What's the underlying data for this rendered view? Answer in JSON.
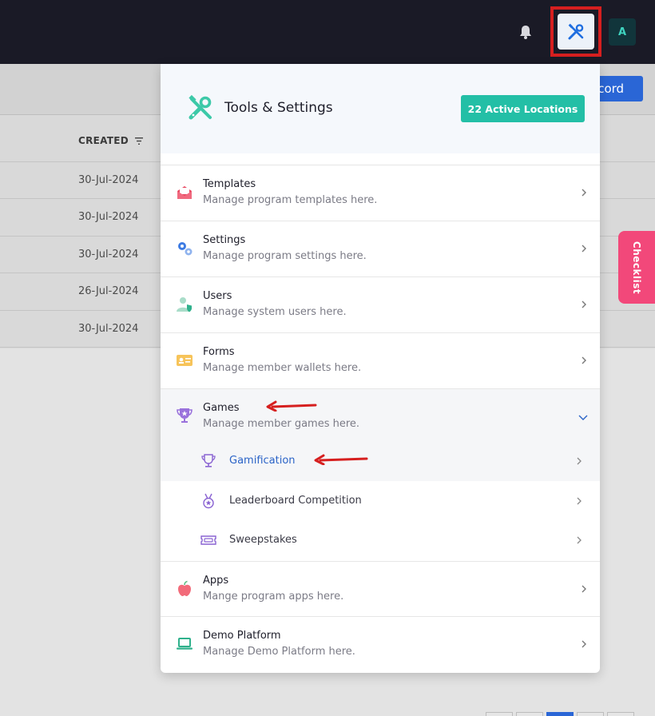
{
  "header": {
    "notifications_icon": "bell-icon",
    "tools_icon": "tools-icon",
    "avatar_initial": "A",
    "highlight_color": "#d61f1f"
  },
  "background_page": {
    "add_button_label": "ecord",
    "column_header": "CREATED",
    "rows": [
      "30-Jul-2024",
      "30-Jul-2024",
      "30-Jul-2024",
      "26-Jul-2024",
      "30-Jul-2024"
    ],
    "checklist_label": "Checklist"
  },
  "panel": {
    "title": "Tools & Settings",
    "locations_button": "22 Active Locations",
    "accent": "#23bfa6",
    "items": [
      {
        "title": "Templates",
        "subtitle": "Manage program templates here.",
        "icon": "envelope-icon"
      },
      {
        "title": "Settings",
        "subtitle": "Manage program settings here.",
        "icon": "gears-icon"
      },
      {
        "title": "Users",
        "subtitle": "Manage system users here.",
        "icon": "user-shield-icon"
      },
      {
        "title": "Forms",
        "subtitle": "Manage member wallets here.",
        "icon": "id-card-icon"
      },
      {
        "title": "Games",
        "subtitle": "Manage member games here.",
        "icon": "trophy-icon",
        "expanded": true
      },
      {
        "title": "Apps",
        "subtitle": "Mange program apps here.",
        "icon": "apple-icon"
      },
      {
        "title": "Demo Platform",
        "subtitle": "Manage Demo Platform here.",
        "icon": "laptop-icon"
      }
    ],
    "games_subitems": [
      {
        "label": "Gamification",
        "icon": "trophy-outline-icon",
        "active": true
      },
      {
        "label": "Leaderboard Competition",
        "icon": "medal-icon"
      },
      {
        "label": "Sweepstakes",
        "icon": "ticket-icon"
      }
    ]
  }
}
